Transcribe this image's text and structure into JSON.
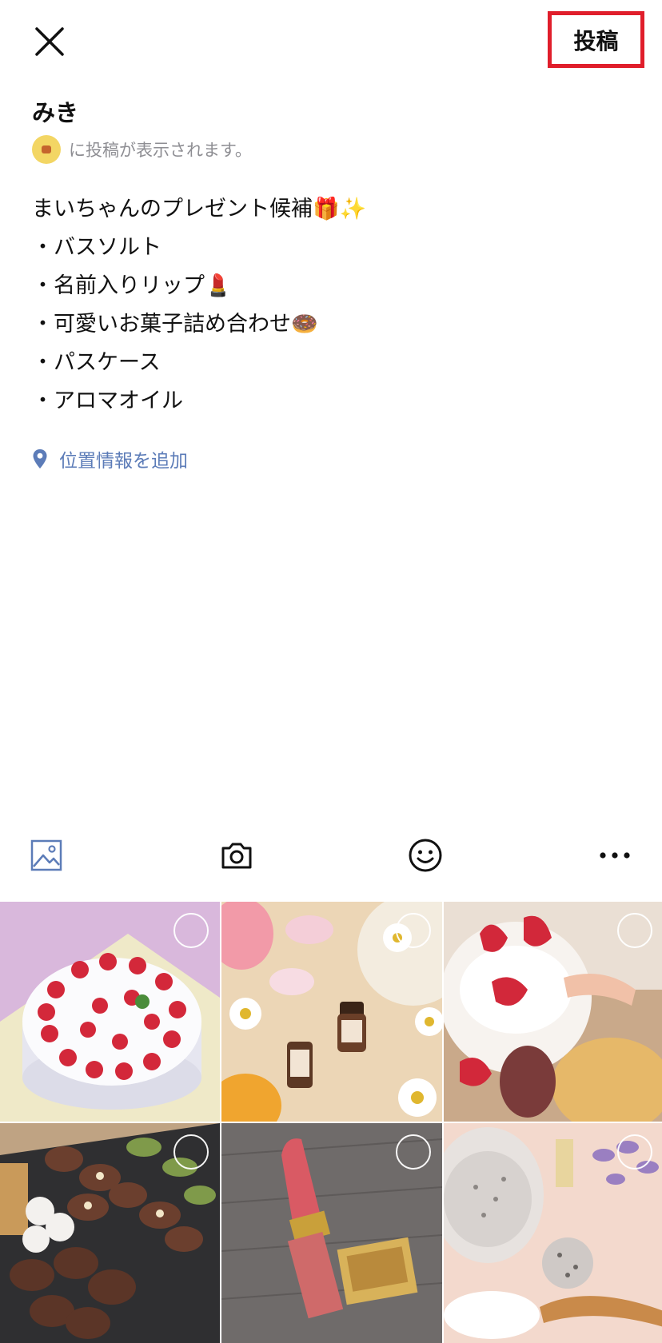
{
  "header": {
    "close_icon": "close-icon",
    "post_label": "投稿"
  },
  "user": {
    "name": "みき",
    "visibility_text": "に投稿が表示されます。"
  },
  "post": {
    "lines": [
      "まいちゃんのプレゼント候補🎁✨",
      "・バスソルト",
      "・名前入りリップ💄",
      "・可愛いお菓子詰め合わせ🍩",
      "・パスケース",
      "・アロマオイル"
    ]
  },
  "location": {
    "label": "位置情報を追加",
    "icon": "location-pin-icon"
  },
  "toolbar": {
    "icons": [
      "image-icon",
      "camera-icon",
      "emoji-icon",
      "more-icon"
    ]
  },
  "photos": [
    {
      "name": "photo-strawberry-cake"
    },
    {
      "name": "photo-aroma-oil"
    },
    {
      "name": "photo-strawberry-desserts"
    },
    {
      "name": "photo-cookies"
    },
    {
      "name": "photo-lipstick"
    },
    {
      "name": "photo-bath-salt"
    }
  ],
  "colors": {
    "highlight_border": "#e01e2b",
    "link_blue": "#5c7cb8",
    "muted_gray": "#8e8e93"
  }
}
